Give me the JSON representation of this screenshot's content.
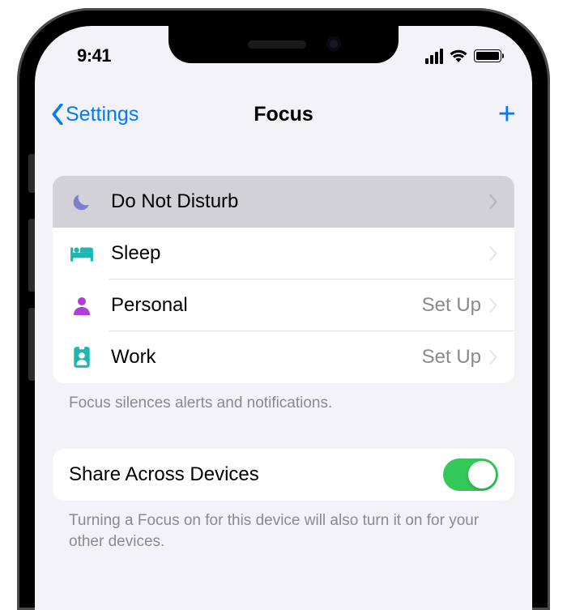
{
  "status": {
    "time": "9:41"
  },
  "nav": {
    "back_label": "Settings",
    "title": "Focus"
  },
  "focus_list": [
    {
      "icon": "moon-icon",
      "label": "Do Not Disturb",
      "detail": "",
      "highlighted": true
    },
    {
      "icon": "bed-icon",
      "label": "Sleep",
      "detail": "",
      "highlighted": false
    },
    {
      "icon": "person-icon",
      "label": "Personal",
      "detail": "Set Up",
      "highlighted": false
    },
    {
      "icon": "badge-icon",
      "label": "Work",
      "detail": "Set Up",
      "highlighted": false
    }
  ],
  "focus_footer": "Focus silences alerts and notifications.",
  "share": {
    "label": "Share Across Devices",
    "on": true,
    "footer": "Turning a Focus on for this device will also turn it on for your other devices."
  }
}
